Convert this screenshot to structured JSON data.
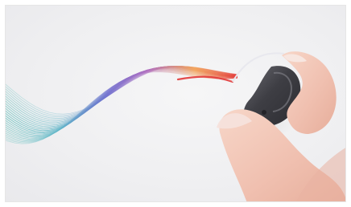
{
  "scene": {
    "subject": "hearing-aid",
    "colors": {
      "background": "#f0f0f2",
      "wave_start": "#58c2b8",
      "wave_mid": "#6f6fcf",
      "wave_mid2": "#b06fc0",
      "wave_warm": "#f2a054",
      "wave_end": "#e23a3a",
      "device_body": "#4c4c52",
      "skin": "#f2c3b4"
    },
    "icons": {
      "wave": "sound-wave-icon",
      "device": "hearing-aid-icon",
      "hand": "hand-icon"
    }
  }
}
